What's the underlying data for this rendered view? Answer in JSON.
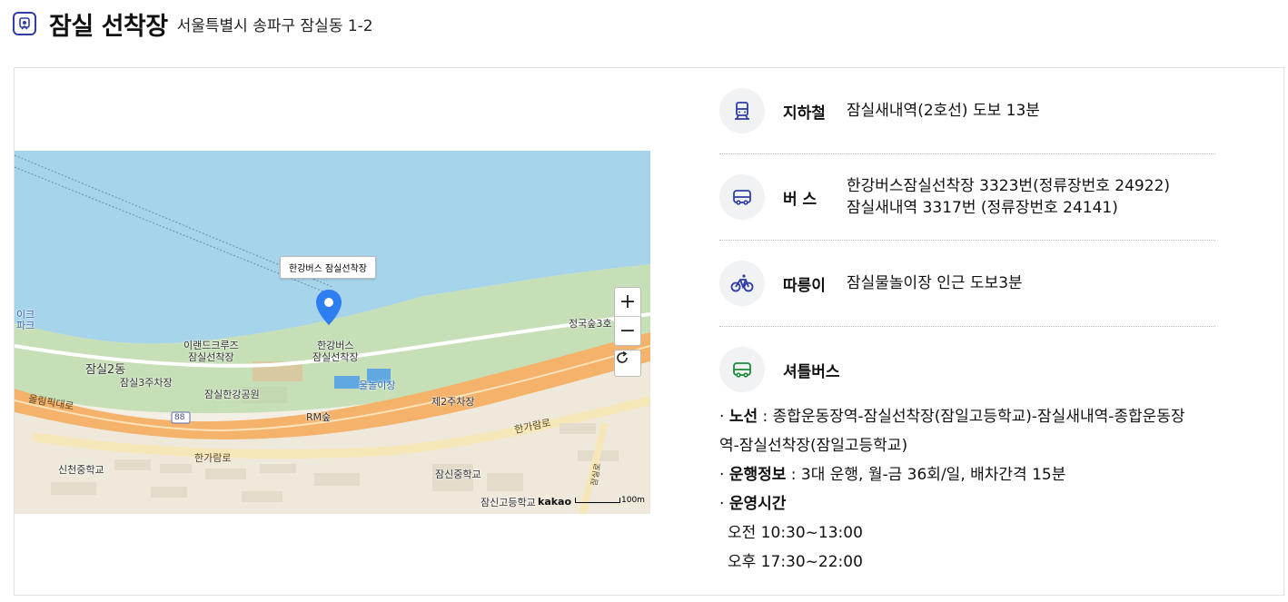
{
  "header": {
    "title": "잠실 선착장",
    "address": "서울특별시 송파구 잠실동 1-2"
  },
  "map": {
    "marker_label": "한강버스 잠실선착장",
    "labels": {
      "station": "한강버스\n잠실선착장",
      "ireland": "이랜드크루즈\n잠실선착장",
      "jamsil2": "잠실2동",
      "parking3": "잠실3주차장",
      "park": "잠실한강공원",
      "waterplay": "물놀이장",
      "parking2": "제2주차장",
      "rm": "RM숲",
      "olympic": "올림픽대로",
      "hangaram": "한가람로",
      "hangaram2": "한가람로",
      "sincheon": "신천중학교",
      "jamsin_mid": "잠신중학교",
      "jamsin_high": "잠신고등학교",
      "jeongguk": "정국숲3호",
      "edge_top": "이크",
      "edge_bottom": "파크",
      "jamsilro": "잠실로",
      "route88": "88"
    },
    "zoom_in": "+",
    "zoom_out": "−",
    "logo": "kakao",
    "scale": "100m"
  },
  "transport": {
    "subway": {
      "label": "지하철",
      "value": "잠실새내역(2호선) 도보 13분",
      "icon": "subway-icon",
      "color": "#2f3da8"
    },
    "bus": {
      "label": "버 스",
      "lines": [
        "한강버스잠실선착장 3323번(정류장번호 24922)",
        "잠실새내역 3317번 (정류장번호 24141)"
      ],
      "icon": "bus-icon",
      "color": "#2f3da8"
    },
    "bike": {
      "label": "따릉이",
      "value": "잠실물놀이장 인근 도보3분",
      "icon": "bicycle-icon",
      "color": "#2f3da8"
    },
    "shuttle": {
      "label": "셔틀버스",
      "icon": "shuttle-bus-icon",
      "color": "#1f8a3a"
    }
  },
  "shuttle_details": {
    "route_label": "노선",
    "route_value": " : 종합운동장역-잠실선착장(잠일고등학교)-잠실새내역-종합운동장",
    "route_value_cont": "역-잠실선착장(잠일고등학교)",
    "ops_label": "운행정보",
    "ops_value": " : 3대 운행, 월-금 36회/일, 배차간격 15분",
    "hours_label": "운영시간",
    "am": "오전 10:30~13:00",
    "pm": "오후 17:30~22:00"
  }
}
